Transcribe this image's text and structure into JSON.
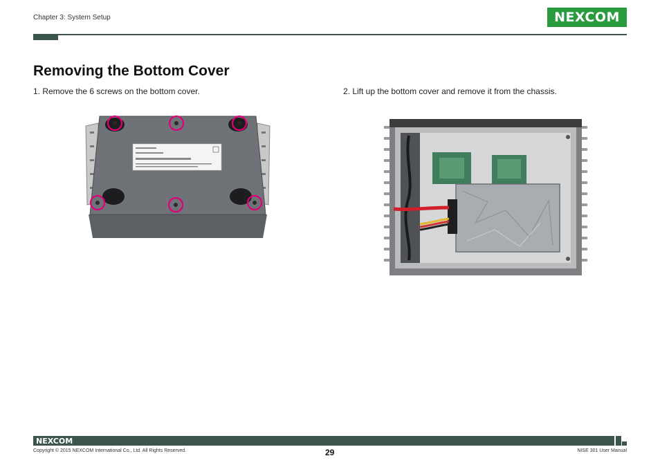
{
  "header": {
    "chapter": "Chapter 3: System Setup",
    "logo": "NEXCOM",
    "brand_color": "#2a9a3e",
    "bar_color": "#3c564d"
  },
  "content": {
    "title": "Removing the Bottom Cover",
    "step1": "1. Remove the 6 screws on the bottom cover.",
    "step2": "2. Lift up the bottom cover and remove it from the chassis.",
    "screw_marker_color": "#e0007a"
  },
  "footer": {
    "logo": "NEXCOM",
    "copyright": "Copyright © 2015 NEXCOM International Co., Ltd. All Rights Reserved.",
    "page_number": "29",
    "manual": "NISE 301 User Manual"
  }
}
